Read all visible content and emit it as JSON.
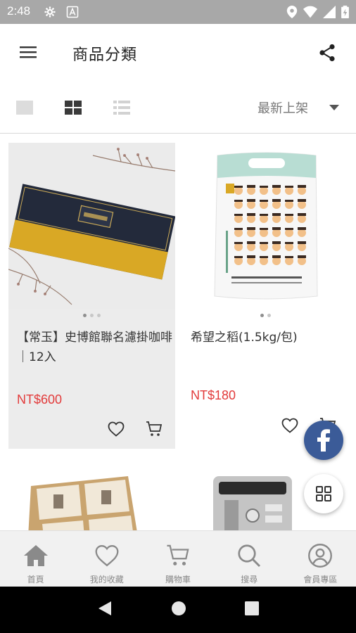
{
  "status_bar": {
    "time": "2:48"
  },
  "app_bar": {
    "title": "商品分類"
  },
  "toolbar": {
    "sort_label": "最新上架"
  },
  "products": [
    {
      "title": "【常玉】史博館聯名濾掛咖啡｜12入",
      "price": "NT$600"
    },
    {
      "title": "希望之稻(1.5kg/包)",
      "price": "NT$180"
    }
  ],
  "bottom_nav": [
    {
      "label": "首頁",
      "icon": "home-icon"
    },
    {
      "label": "我的收藏",
      "icon": "heart-icon"
    },
    {
      "label": "購物車",
      "icon": "cart-icon"
    },
    {
      "label": "搜尋",
      "icon": "search-icon"
    },
    {
      "label": "會員專區",
      "icon": "account-icon"
    }
  ],
  "colors": {
    "price": "#e23b3b",
    "facebook": "#3b5b98",
    "status_bar": "#a8a8a8"
  }
}
